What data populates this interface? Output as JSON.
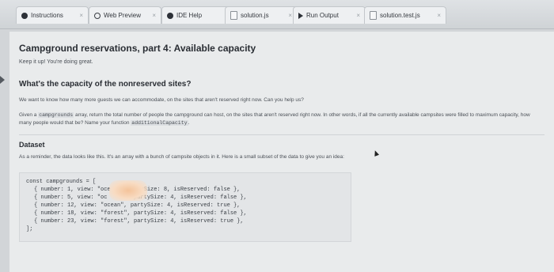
{
  "tabs": [
    {
      "label": "Instructions",
      "icon": "info-icon"
    },
    {
      "label": "Web Preview",
      "icon": "globe-icon"
    },
    {
      "label": "IDE Help",
      "icon": "info-icon"
    },
    {
      "label": "solution.js",
      "icon": "file-icon"
    },
    {
      "label": "Run Output",
      "icon": "play-icon"
    },
    {
      "label": "solution.test.js",
      "icon": "file-icon"
    }
  ],
  "close_glyph": "×",
  "content": {
    "title": "Campground reservations, part 4: Available capacity",
    "subtitle": "Keep it up! You're doing great.",
    "question_heading": "What's the capacity of the nonreserved sites?",
    "intro": "We want to know how many more guests we can accommodate, on the sites that aren't reserved right now. Can you help us?",
    "task_prefix": "Given a",
    "task_code1": "campgrounds",
    "task_middle": "array, return the total number of people the campground can host, on the sites that aren't reserved right now. In other words, if all the currently available campsites were filled to maximum capacity, how many people would that be? Name your function",
    "task_code2": "additionalCapacity",
    "task_end": ".",
    "dataset_heading": "Dataset",
    "dataset_text": "As a reminder, the data looks like this. It's an array with a bunch of campsite objects in it. Here is a small subset of the data to give you an idea:"
  },
  "code": {
    "open": "const campgrounds = [",
    "rows": [
      "{ number: 1, view: \"oce      artySize: 8, isReserved: false },",
      "{ number: 5, view: \"oc        partySize: 4, isReserved: false },",
      "{ number: 12, view: \"ocean\", partySize: 4, isReserved: true },",
      "{ number: 18, view: \"forest\", partySize: 4, isReserved: false },",
      "{ number: 23, view: \"forest\", partySize: 4, isReserved: true },"
    ],
    "close": "];"
  }
}
